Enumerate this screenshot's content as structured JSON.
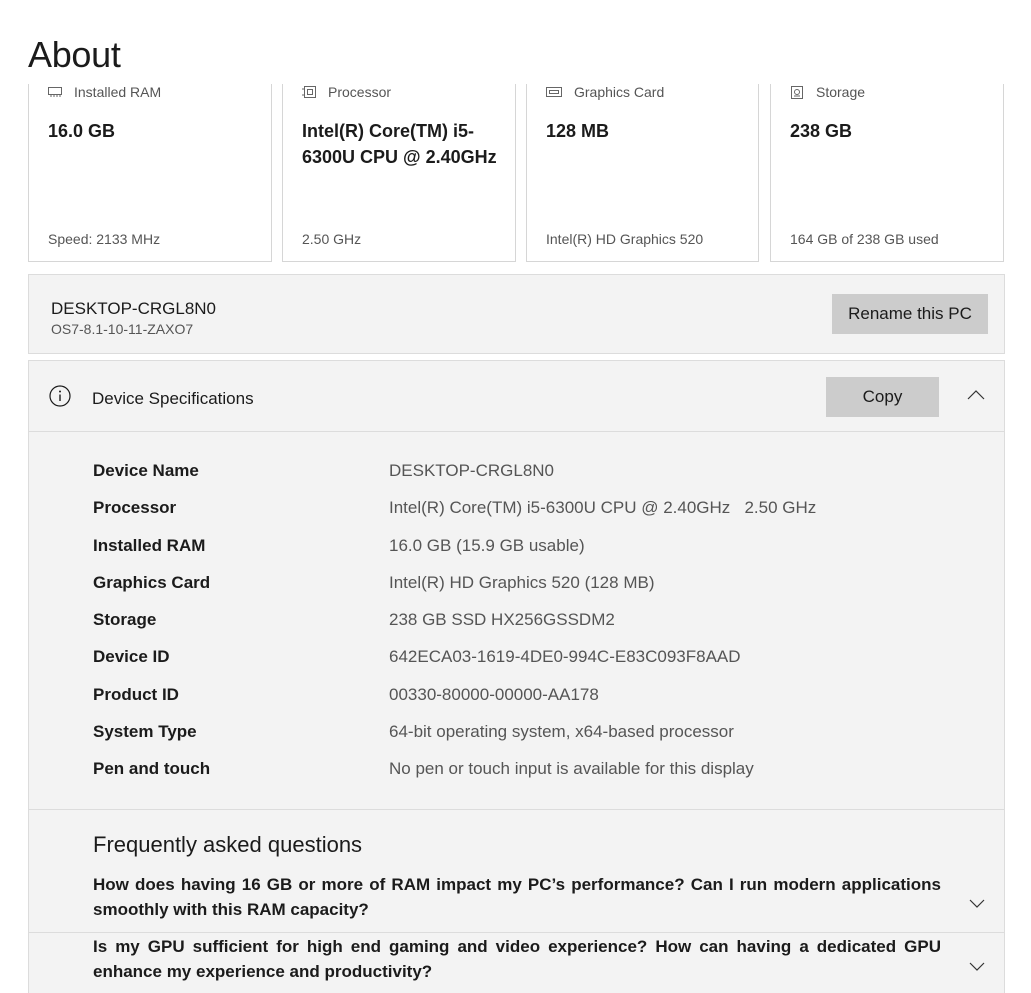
{
  "page": {
    "title": "About"
  },
  "cards": [
    {
      "icon": "ram-icon",
      "label": "Installed RAM",
      "value": "16.0 GB",
      "sub": "Speed: 2133 MHz"
    },
    {
      "icon": "processor-icon",
      "label": "Processor",
      "value": "Intel(R) Core(TM) i5-6300U CPU @ 2.40GHz",
      "sub": "2.50 GHz"
    },
    {
      "icon": "graphics-card-icon",
      "label": "Graphics Card",
      "value": "128 MB",
      "sub": "Intel(R) HD Graphics 520"
    },
    {
      "icon": "storage-icon",
      "label": "Storage",
      "value": "238 GB",
      "sub": "164 GB of 238 GB used"
    }
  ],
  "pc": {
    "name": "DESKTOP-CRGL8N0",
    "model": "OS7-8.1-10-11-ZAXO7",
    "rename_label": "Rename this PC"
  },
  "specs": {
    "title": "Device Specifications",
    "copy_label": "Copy",
    "rows": [
      {
        "label": "Device Name",
        "value": "DESKTOP-CRGL8N0"
      },
      {
        "label": "Processor",
        "value": "Intel(R) Core(TM) i5-6300U CPU @ 2.40GHz   2.50 GHz"
      },
      {
        "label": "Installed RAM",
        "value": "16.0 GB (15.9 GB usable)"
      },
      {
        "label": "Graphics Card",
        "value": "Intel(R) HD Graphics 520 (128 MB)"
      },
      {
        "label": "Storage",
        "value": "238 GB SSD HX256GSSDM2"
      },
      {
        "label": "Device ID",
        "value": "642ECA03-1619-4DE0-994C-E83C093F8AAD"
      },
      {
        "label": "Product ID",
        "value": "00330-80000-00000-AA178"
      },
      {
        "label": "System Type",
        "value": "64-bit operating system, x64-based processor"
      },
      {
        "label": "Pen and touch",
        "value": "No pen or touch input is available for this display"
      }
    ]
  },
  "faq": {
    "title": "Frequently asked questions",
    "items": [
      {
        "question": "How does having 16 GB or more of RAM impact my PC’s performance? Can I run modern applications smoothly with this RAM capacity?"
      },
      {
        "question": "Is my GPU sufficient for high end gaming and video experience? How can having a dedicated GPU enhance my experience and productivity?"
      }
    ]
  }
}
